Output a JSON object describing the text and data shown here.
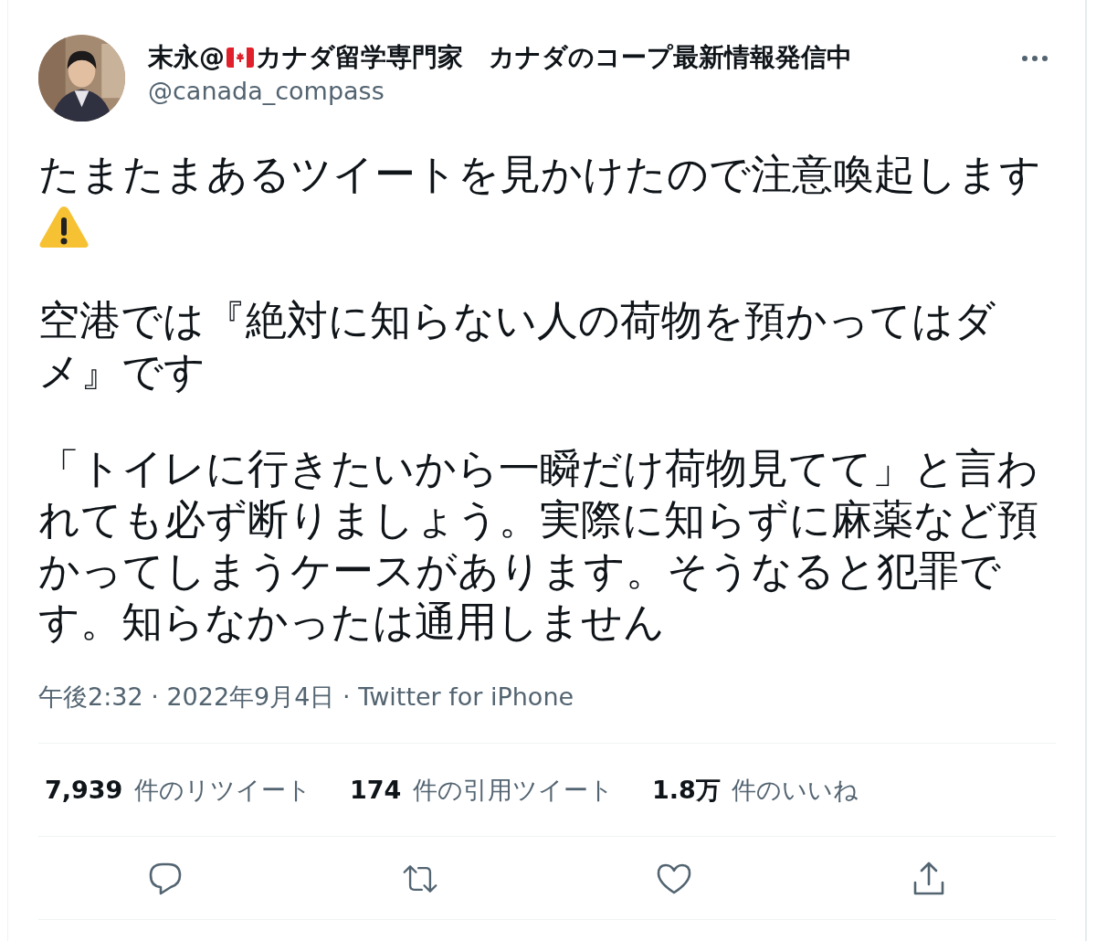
{
  "author": {
    "name_before_flag": "末永@",
    "name_after_flag": "カナダ留学専門家　カナダのコープ最新情報発信中",
    "handle": "@canada_compass"
  },
  "paragraphs": [
    {
      "text": "たまたまあるツイートを見かけたので注意喚起します",
      "warning_sign": true
    },
    {
      "text": "空港では『絶対に知らない人の荷物を預かってはダメ』です"
    },
    {
      "text": "「トイレに行きたいから一瞬だけ荷物見てて」と言われても必ず断りましょう。実際に知らずに麻薬など預かってしまうケースがあります。そうなると犯罪です。知らなかったは通用しません"
    }
  ],
  "timestamp": "午後2:32 · 2022年9月4日 · Twitter for iPhone",
  "stats": [
    {
      "count": "7,939",
      "label": "件のリツイート"
    },
    {
      "count": "174",
      "label": "件の引用ツイート"
    },
    {
      "count": "1.8万",
      "label": "件のいいね"
    }
  ]
}
